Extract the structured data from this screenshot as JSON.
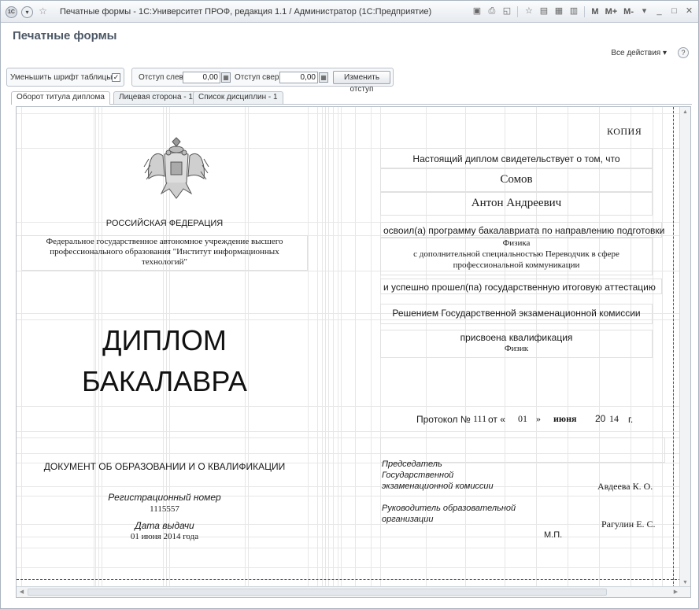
{
  "window": {
    "title": "Печатные формы - 1С:Университет ПРОФ, редакция 1.1 / Администратор  (1С:Предприятие)",
    "logo": "1C",
    "toolbar_icons": [
      "save-icon",
      "print-icon",
      "preview-icon",
      "favorite-icon",
      "favorites-list-icon",
      "calculator-icon",
      "calendar-icon"
    ],
    "memory_buttons": [
      "M",
      "M+",
      "M-"
    ]
  },
  "page": {
    "title": "Печатные формы",
    "all_actions": "Все действия ▾",
    "help": "?"
  },
  "toolbar": {
    "reduce_font_label": "Уменьшить шрифт таблицы:",
    "reduce_font_checked": "✓",
    "left_indent_label": "Отступ слева:",
    "left_indent_value": "0,00",
    "top_indent_label": "Отступ сверху:",
    "top_indent_value": "0,00",
    "change_indent_button": "Изменить отступ"
  },
  "tabs": [
    {
      "label": "Оборот титула диплома",
      "active": true
    },
    {
      "label": "Лицевая сторона - 1",
      "active": false
    },
    {
      "label": "Список дисциплин - 1",
      "active": false
    }
  ],
  "diploma": {
    "left": {
      "country": "РОССИЙСКАЯ ФЕДЕРАЦИЯ",
      "institution_line1": "Федеральное государственное автономное учреждение высшего",
      "institution_line2": "профессионального образования \"Институт информационных",
      "institution_line3": "технологий\"",
      "title_line1": "ДИПЛОМ",
      "title_line2": "БАКАЛАВРА",
      "doc_type": "ДОКУМЕНТ ОБ ОБРАЗОВАНИИ И О КВАЛИФИКАЦИИ",
      "reg_label": "Регистрационный номер",
      "reg_number": "1115557",
      "issue_label": "Дата выдачи",
      "issue_date": "01 июня 2014 года"
    },
    "right": {
      "copy_mark": "КОПИЯ",
      "certifies": "Настоящий диплом свидетельствует о том, что",
      "surname": "Сомов",
      "name": "Антон Андреевич",
      "mastered": "освоил(а) программу бакалавриата по направлению подготовки",
      "direction": "Физика",
      "specialty_line1": "с дополнительной специальностью Переводчик в сфере",
      "specialty_line2": "профессиональной коммуникации",
      "passed": "и успешно прошел(па) государственную итоговую аттестацию",
      "decision": "Решением Государственной экзаменационной комиссии",
      "awarded": "присвоена квалификация",
      "qualification": "Физик",
      "protocol_label": "Протокол №",
      "protocol_number": "111",
      "from": "от «",
      "day": "01",
      "quote_close": "»",
      "month": "июня",
      "year_prefix": "20",
      "year_suffix": "14",
      "year_g": "г.",
      "chair_line1": "Председатель",
      "chair_line2": "Государственной",
      "chair_line3": "экзаменационной комиссии",
      "chair_name": "Авдеева К. О.",
      "head_line1": "Руководитель образовательной",
      "head_line2": "организации",
      "head_name": "Рагулин Е. С.",
      "stamp": "М.П."
    }
  }
}
